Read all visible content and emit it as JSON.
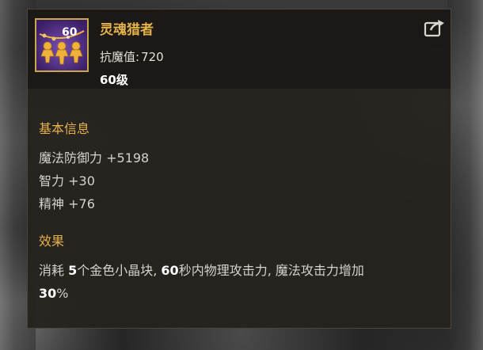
{
  "item": {
    "name": "灵魂猎者",
    "icon_level": "60",
    "resist_label": "抗魔值:",
    "resist_value": "720",
    "level": "60级"
  },
  "sections": {
    "basic_title": "基本信息",
    "stats": [
      {
        "label": "魔法防御力",
        "value": "+5198"
      },
      {
        "label": "智力",
        "value": "+30"
      },
      {
        "label": "精神",
        "value": "+76"
      }
    ],
    "effect_title": "效果",
    "effect": {
      "part1": "消耗 ",
      "num1": "5",
      "part2": "个金色小晶块, ",
      "num2": "60",
      "part3": "秒内物理攻击力, 魔法攻击力增加",
      "num3": "30",
      "part4": "%"
    }
  },
  "colors": {
    "accent_gold": "#e4b24a",
    "icon_bg_purple": "#4b2e7a",
    "tooltip_bg": "#26221e"
  },
  "icons": {
    "item_icon": "soul-hunter-icon",
    "share_icon": "share-icon"
  }
}
